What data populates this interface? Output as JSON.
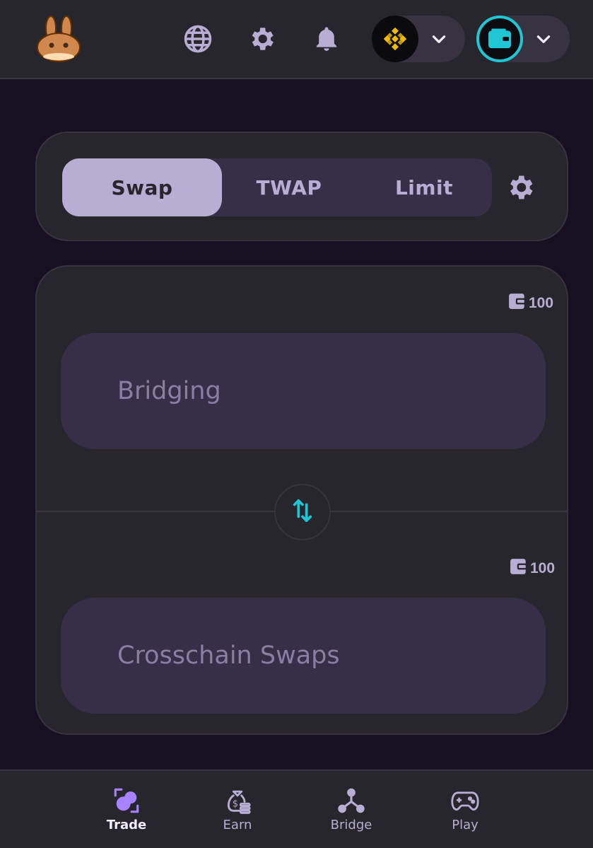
{
  "header": {
    "logo_icon": "pancake-bunny-icon",
    "icons": [
      "globe-icon",
      "gear-icon",
      "bell-icon"
    ],
    "network_selector": {
      "chain_icon": "bnb-chain-icon",
      "arrow_icon": "chevron-down-icon"
    },
    "wallet_selector": {
      "wallet_icon": "wallet-icon",
      "arrow_icon": "chevron-down-icon"
    }
  },
  "tabs": {
    "items": [
      {
        "label": "Swap",
        "active": true
      },
      {
        "label": "TWAP",
        "active": false
      },
      {
        "label": "Limit",
        "active": false
      }
    ],
    "settings_icon": "gear-icon"
  },
  "swap": {
    "from": {
      "balance": "100",
      "placeholder": "Bridging"
    },
    "switch_icon": "swap-arrows-icon",
    "to": {
      "balance": "100",
      "placeholder": "Crosschain Swaps"
    }
  },
  "bottom_nav": {
    "items": [
      {
        "label": "Trade",
        "icon": "trade-icon",
        "active": true
      },
      {
        "label": "Earn",
        "icon": "money-bag-icon",
        "active": false
      },
      {
        "label": "Bridge",
        "icon": "bridge-icon",
        "active": false
      },
      {
        "label": "Play",
        "icon": "gamepad-icon",
        "active": false
      }
    ]
  },
  "colors": {
    "background": "#170f22",
    "card": "#27262c",
    "input": "#372f47",
    "accent": "#1fc7d4",
    "lavender": "#b8add2",
    "active_nav": "#a881fc",
    "bnb_yellow": "#f0b90b"
  }
}
